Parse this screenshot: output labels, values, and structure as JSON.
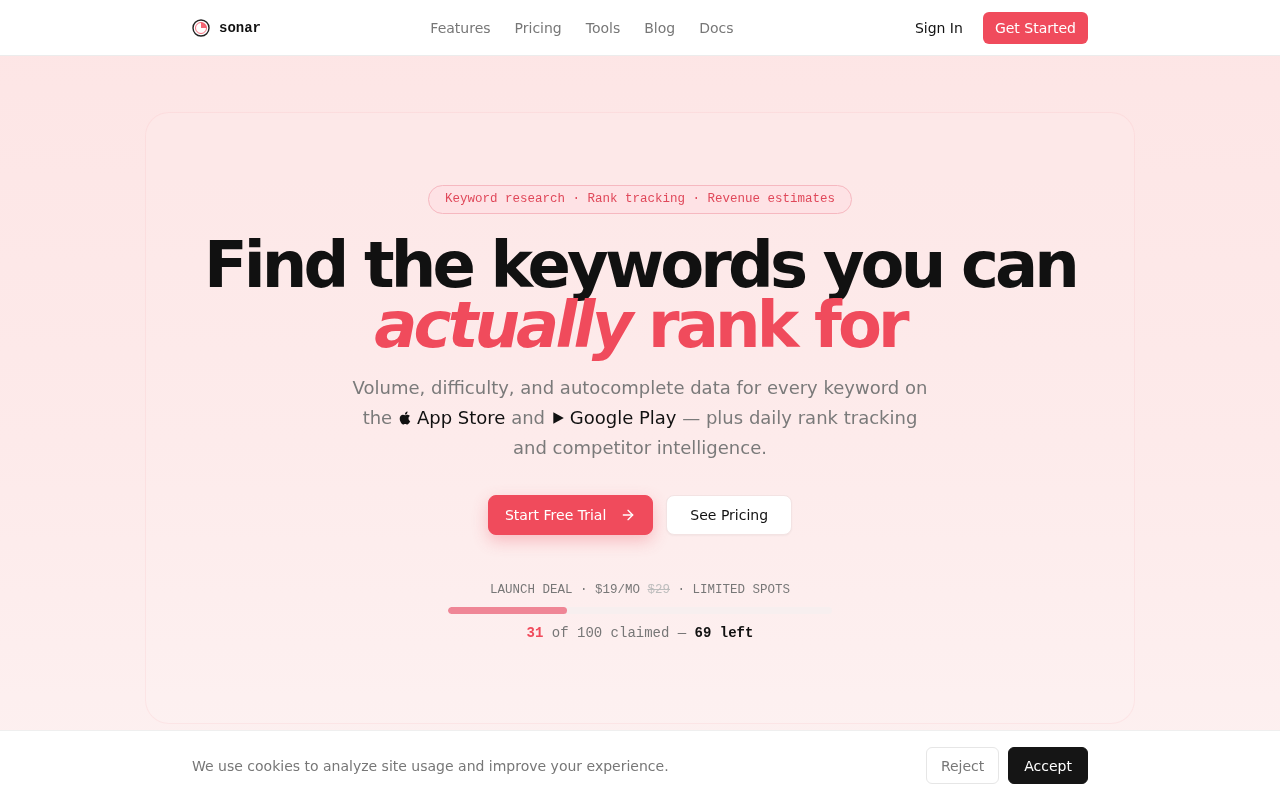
{
  "nav": {
    "logo": "sonar",
    "links": [
      "Features",
      "Pricing",
      "Tools",
      "Blog",
      "Docs"
    ],
    "sign_in": "Sign In",
    "cta": "Get Started"
  },
  "hero": {
    "badge": "Keyword research · Rank tracking · Revenue estimates",
    "headline": {
      "line_1": "Find the keywords you can",
      "line_2": "*actually* rank for"
    },
    "subtitle": {
      "lead": "Volume, difficulty, and autocomplete data for every keyword on the",
      "store_1": "App Store",
      "joiner": "and",
      "store_2": "Google Play",
      "tail": "— plus daily rank tracking and competitor intelligence."
    },
    "buttons": [
      {
        "label": "Start Free Trial",
        "kind": "primary"
      },
      {
        "label": "See Pricing",
        "kind": "secondary"
      }
    ],
    "deal": {
      "label": "LAUNCH DEAL · $19/MO",
      "old_price": "$29",
      "note": "· LIMITED SPOTS",
      "level": 0.31,
      "claimed": "31",
      "claimed_text": "of 100 claimed —",
      "left": "69 left"
    }
  },
  "cookie_banner": {
    "text": "We use cookies to analyze site usage and improve your experience.",
    "buttons": [
      {
        "label": "Reject",
        "kind": "secondary"
      },
      {
        "label": "Accept",
        "kind": "primary"
      }
    ]
  }
}
